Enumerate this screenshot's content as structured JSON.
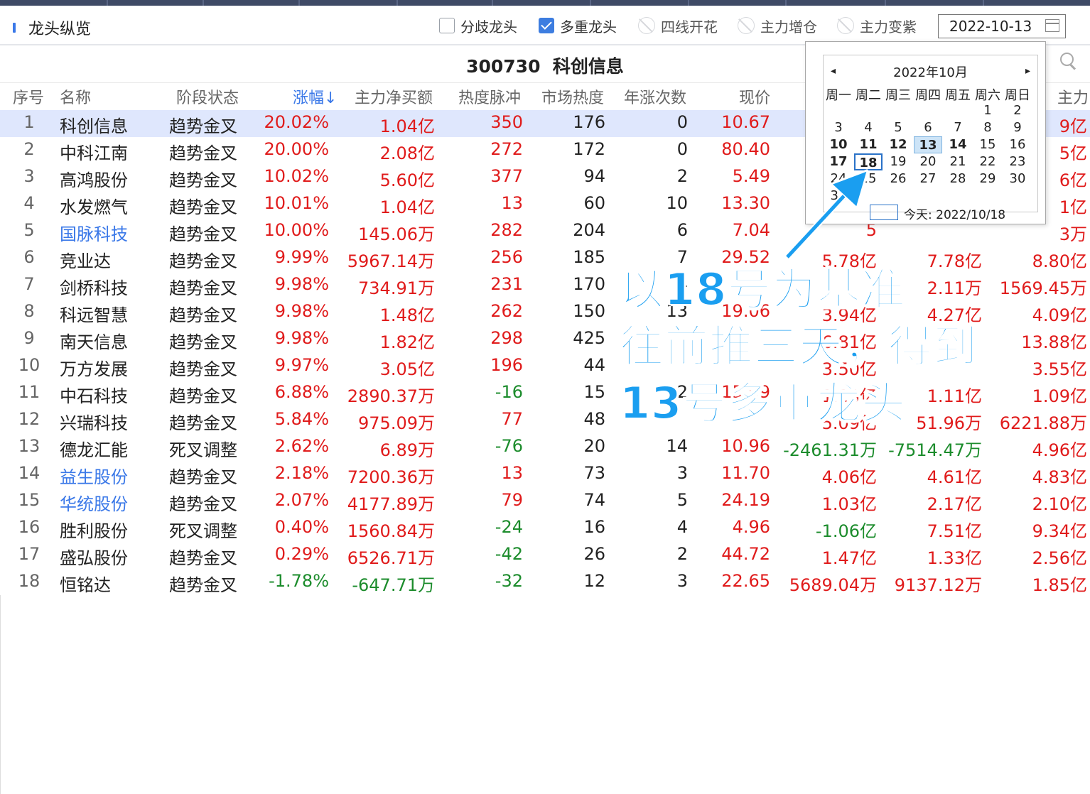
{
  "panel": {
    "title": "龙头纵览"
  },
  "filters": [
    {
      "label": "分歧龙头",
      "state": "unchecked"
    },
    {
      "label": "多重龙头",
      "state": "checked"
    },
    {
      "label": "四线开花",
      "state": "disabled"
    },
    {
      "label": "主力增仓",
      "state": "disabled"
    },
    {
      "label": "主力变紫",
      "state": "disabled"
    }
  ],
  "date_field": {
    "value": "2022-10-13"
  },
  "stock_header": {
    "code": "300730",
    "name": "科创信息"
  },
  "columns": {
    "seq": "序号",
    "name": "名称",
    "stage": "阶段状态",
    "change": "涨幅↓",
    "net_buy": "主力净买额",
    "heat_pulse": "热度脉冲",
    "market_heat": "市场热度",
    "year_rises": "年涨次数",
    "price": "现价",
    "extra": "主力"
  },
  "rows": [
    {
      "seq": "1",
      "name": "科创信息",
      "stage": "趋势金叉",
      "change": "20.02%",
      "net_buy": "1.04亿",
      "heat_pulse": "350",
      "market_heat": "176",
      "year_rises": "0",
      "price": "10.67",
      "c1": "",
      "c2": "",
      "c3": "9亿",
      "name_color": "dark",
      "change_color": "red",
      "net_color": "red",
      "pulse_color": "red",
      "c1_color": "red",
      "c2_color": "red",
      "c3_color": "red"
    },
    {
      "seq": "2",
      "name": "中科江南",
      "stage": "趋势金叉",
      "change": "20.00%",
      "net_buy": "2.08亿",
      "heat_pulse": "272",
      "market_heat": "172",
      "year_rises": "0",
      "price": "80.40",
      "c1": "",
      "c2": "",
      "c3": "5亿",
      "name_color": "dark",
      "change_color": "red",
      "net_color": "red",
      "pulse_color": "red",
      "c1_color": "red",
      "c2_color": "red",
      "c3_color": "red"
    },
    {
      "seq": "3",
      "name": "高鸿股份",
      "stage": "趋势金叉",
      "change": "10.02%",
      "net_buy": "5.60亿",
      "heat_pulse": "377",
      "market_heat": "94",
      "year_rises": "2",
      "price": "5.49",
      "c1": "",
      "c2": "",
      "c3": "6亿",
      "name_color": "dark",
      "change_color": "red",
      "net_color": "red",
      "pulse_color": "red",
      "c1_color": "red",
      "c2_color": "red",
      "c3_color": "red"
    },
    {
      "seq": "4",
      "name": "水发燃气",
      "stage": "趋势金叉",
      "change": "10.01%",
      "net_buy": "1.04亿",
      "heat_pulse": "13",
      "market_heat": "60",
      "year_rises": "10",
      "price": "13.30",
      "c1": "",
      "c2": "",
      "c3": "1亿",
      "name_color": "dark",
      "change_color": "red",
      "net_color": "red",
      "pulse_color": "red",
      "c1_color": "red",
      "c2_color": "red",
      "c3_color": "red"
    },
    {
      "seq": "5",
      "name": "国脉科技",
      "stage": "趋势金叉",
      "change": "10.00%",
      "net_buy": "145.06万",
      "heat_pulse": "282",
      "market_heat": "204",
      "year_rises": "6",
      "price": "7.04",
      "c1": "5",
      "c2": "",
      "c3": "3万",
      "name_color": "blue",
      "change_color": "red",
      "net_color": "red",
      "pulse_color": "red",
      "c1_color": "red",
      "c2_color": "red",
      "c3_color": "red"
    },
    {
      "seq": "6",
      "name": "竞业达",
      "stage": "趋势金叉",
      "change": "9.99%",
      "net_buy": "5967.14万",
      "heat_pulse": "256",
      "market_heat": "185",
      "year_rises": "7",
      "price": "29.52",
      "c1": "5.78亿",
      "c2": "7.78亿",
      "c3": "8.80亿",
      "name_color": "dark",
      "change_color": "red",
      "net_color": "red",
      "pulse_color": "red",
      "c1_color": "red",
      "c2_color": "red",
      "c3_color": "red"
    },
    {
      "seq": "7",
      "name": "剑桥科技",
      "stage": "趋势金叉",
      "change": "9.98%",
      "net_buy": "734.91万",
      "heat_pulse": "231",
      "market_heat": "170",
      "year_rises": "4",
      "price": "",
      "c1": "",
      "c2": "2.11万",
      "c3": "1569.45万",
      "name_color": "dark",
      "change_color": "red",
      "net_color": "red",
      "pulse_color": "red",
      "c1_color": "red",
      "c2_color": "red",
      "c3_color": "red"
    },
    {
      "seq": "8",
      "name": "科远智慧",
      "stage": "趋势金叉",
      "change": "9.98%",
      "net_buy": "1.48亿",
      "heat_pulse": "262",
      "market_heat": "150",
      "year_rises": "13",
      "price": "19.06",
      "c1": "3.94亿",
      "c2": "4.27亿",
      "c3": "4.09亿",
      "name_color": "dark",
      "change_color": "red",
      "net_color": "red",
      "pulse_color": "red",
      "c1_color": "red",
      "c2_color": "red",
      "c3_color": "red"
    },
    {
      "seq": "9",
      "name": "南天信息",
      "stage": "趋势金叉",
      "change": "9.98%",
      "net_buy": "1.82亿",
      "heat_pulse": "298",
      "market_heat": "425",
      "year_rises": "",
      "price": "",
      "c1": "6.81亿",
      "c2": "",
      "c3": "13.88亿",
      "name_color": "dark",
      "change_color": "red",
      "net_color": "red",
      "pulse_color": "red",
      "c1_color": "red",
      "c2_color": "red",
      "c3_color": "red"
    },
    {
      "seq": "10",
      "name": "万方发展",
      "stage": "趋势金叉",
      "change": "9.97%",
      "net_buy": "3.05亿",
      "heat_pulse": "196",
      "market_heat": "44",
      "year_rises": "",
      "price": "",
      "c1": "3.50亿",
      "c2": "",
      "c3": "3.55亿",
      "name_color": "dark",
      "change_color": "red",
      "net_color": "red",
      "pulse_color": "red",
      "c1_color": "red",
      "c2_color": "red",
      "c3_color": "red"
    },
    {
      "seq": "11",
      "name": "中石科技",
      "stage": "趋势金叉",
      "change": "6.88%",
      "net_buy": "2890.37万",
      "heat_pulse": "-16",
      "market_heat": "15",
      "year_rises": "2",
      "price": "15.69",
      "c1": "1.13亿",
      "c2": "1.11亿",
      "c3": "1.09亿",
      "name_color": "dark",
      "change_color": "red",
      "net_color": "red",
      "pulse_color": "green",
      "c1_color": "red",
      "c2_color": "red",
      "c3_color": "red"
    },
    {
      "seq": "12",
      "name": "兴瑞科技",
      "stage": "趋势金叉",
      "change": "5.84%",
      "net_buy": "975.09万",
      "heat_pulse": "77",
      "market_heat": "48",
      "year_rises": "",
      "price": "",
      "c1": "5.09亿",
      "c2": "51.96万",
      "c3": "6221.88万",
      "name_color": "dark",
      "change_color": "red",
      "net_color": "red",
      "pulse_color": "red",
      "c1_color": "red",
      "c2_color": "red",
      "c3_color": "red"
    },
    {
      "seq": "13",
      "name": "德龙汇能",
      "stage": "死叉调整",
      "change": "2.62%",
      "net_buy": "6.89万",
      "heat_pulse": "-76",
      "market_heat": "20",
      "year_rises": "14",
      "price": "10.96",
      "c1": "-2461.31万",
      "c2": "-7514.47万",
      "c3": "4.96亿",
      "name_color": "dark",
      "change_color": "red",
      "net_color": "red",
      "pulse_color": "green",
      "c1_color": "green",
      "c2_color": "green",
      "c3_color": "red"
    },
    {
      "seq": "14",
      "name": "益生股份",
      "stage": "趋势金叉",
      "change": "2.18%",
      "net_buy": "7200.36万",
      "heat_pulse": "13",
      "market_heat": "73",
      "year_rises": "3",
      "price": "11.70",
      "c1": "4.06亿",
      "c2": "4.61亿",
      "c3": "4.83亿",
      "name_color": "blue",
      "change_color": "red",
      "net_color": "red",
      "pulse_color": "red",
      "c1_color": "red",
      "c2_color": "red",
      "c3_color": "red"
    },
    {
      "seq": "15",
      "name": "华统股份",
      "stage": "趋势金叉",
      "change": "2.07%",
      "net_buy": "4177.89万",
      "heat_pulse": "79",
      "market_heat": "74",
      "year_rises": "5",
      "price": "24.19",
      "c1": "1.03亿",
      "c2": "2.17亿",
      "c3": "2.10亿",
      "name_color": "blue",
      "change_color": "red",
      "net_color": "red",
      "pulse_color": "red",
      "c1_color": "red",
      "c2_color": "red",
      "c3_color": "red"
    },
    {
      "seq": "16",
      "name": "胜利股份",
      "stage": "死叉调整",
      "change": "0.40%",
      "net_buy": "1560.84万",
      "heat_pulse": "-24",
      "market_heat": "16",
      "year_rises": "4",
      "price": "4.96",
      "c1": "-1.06亿",
      "c2": "7.51亿",
      "c3": "9.34亿",
      "name_color": "dark",
      "change_color": "red",
      "net_color": "red",
      "pulse_color": "green",
      "c1_color": "green",
      "c2_color": "red",
      "c3_color": "red"
    },
    {
      "seq": "17",
      "name": "盛弘股份",
      "stage": "趋势金叉",
      "change": "0.29%",
      "net_buy": "6526.71万",
      "heat_pulse": "-42",
      "market_heat": "26",
      "year_rises": "2",
      "price": "44.72",
      "c1": "1.47亿",
      "c2": "1.33亿",
      "c3": "2.56亿",
      "name_color": "dark",
      "change_color": "red",
      "net_color": "red",
      "pulse_color": "green",
      "c1_color": "red",
      "c2_color": "red",
      "c3_color": "red"
    },
    {
      "seq": "18",
      "name": "恒铭达",
      "stage": "趋势金叉",
      "change": "-1.78%",
      "net_buy": "-647.71万",
      "heat_pulse": "-32",
      "market_heat": "12",
      "year_rises": "3",
      "price": "22.65",
      "c1": "5689.04万",
      "c2": "9137.12万",
      "c3": "1.85亿",
      "name_color": "dark",
      "change_color": "green",
      "net_color": "green",
      "pulse_color": "green",
      "c1_color": "red",
      "c2_color": "red",
      "c3_color": "red"
    }
  ],
  "calendar": {
    "month_label": "2022年10月",
    "prev": "◂",
    "next": "▸",
    "weekdays": [
      "周一",
      "周二",
      "周三",
      "周四",
      "周五",
      "周六",
      "周日"
    ],
    "weeks": [
      [
        "",
        "",
        "",
        "",
        "",
        "1",
        "2"
      ],
      [
        "3",
        "4",
        "5",
        "6",
        "7",
        "8",
        "9"
      ],
      [
        "10",
        "11",
        "12",
        "13",
        "14",
        "15",
        "16"
      ],
      [
        "17",
        "18",
        "19",
        "20",
        "21",
        "22",
        "23"
      ],
      [
        "24",
        "25",
        "26",
        "27",
        "28",
        "29",
        "30"
      ],
      [
        "31",
        "",
        "",
        "",
        "",
        "",
        ""
      ]
    ],
    "bold_days": [
      "10",
      "11",
      "12",
      "13",
      "14",
      "17",
      "18"
    ],
    "selected_day": "13",
    "today_day": "18",
    "today_label": "今天: 2022/10/18"
  },
  "annotation": {
    "lines": [
      "以18号为基准",
      "往前推三天，得到",
      "13号多重龙头"
    ],
    "color": "#1a9ef0"
  },
  "colors": {
    "red": "#e01b1b",
    "green": "#1c8c2c",
    "blue": "#3a78e8",
    "selected_row": "#dfe7fd"
  }
}
